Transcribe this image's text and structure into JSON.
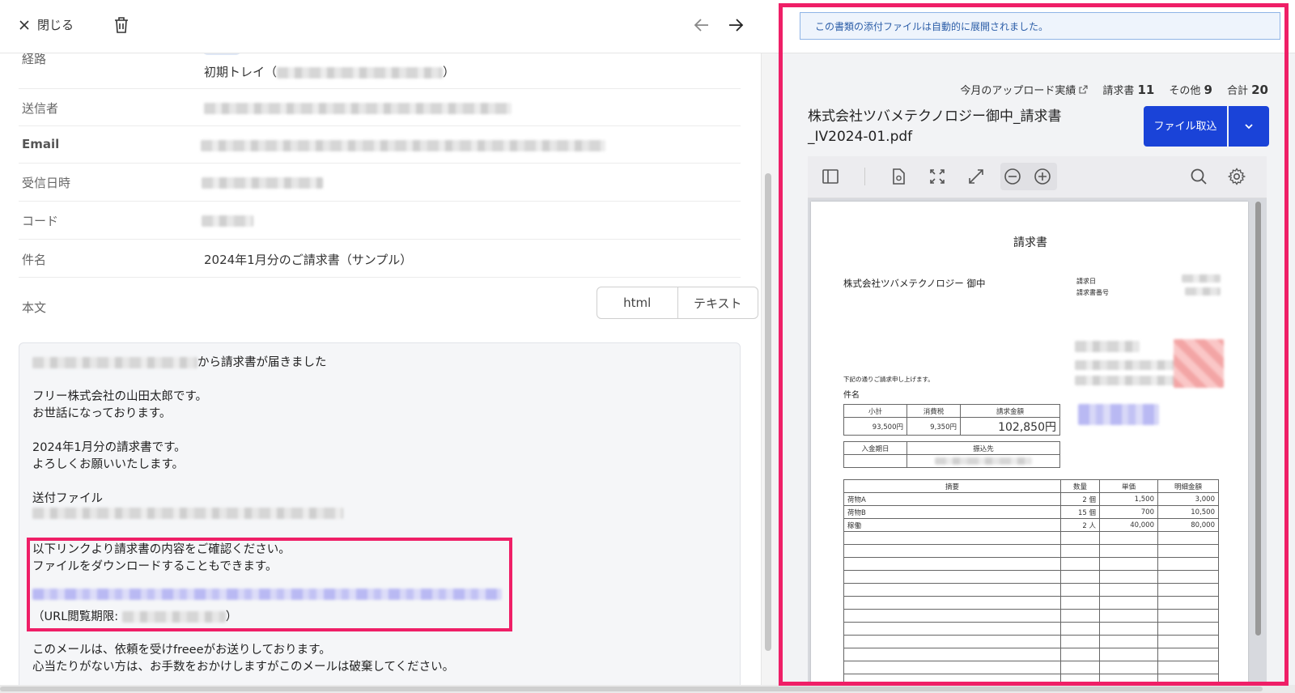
{
  "topbar": {
    "close_label": "閉じる"
  },
  "fields": {
    "route_label": "経路",
    "route_value": "初期トレイ（",
    "route_value_end": "）",
    "sender_label": "送信者",
    "email_label": "Email",
    "received_label": "受信日時",
    "code_label": "コード",
    "subject_label": "件名",
    "subject_value": "2024年1月分のご請求書（サンプル）",
    "body_label": "本文",
    "body_modes": [
      "html",
      "テキスト"
    ]
  },
  "mail_body": {
    "line1_suffix": "から請求書が届きました",
    "line2": "フリー株式会社の山田太郎です。",
    "line3": "お世話になっております。",
    "line4": "2024年1月分の請求書です。",
    "line5": "よろしくお願いいたします。",
    "line6": "送付ファイル",
    "line7": "以下リンクより請求書の内容をご確認ください。",
    "line8": "ファイルをダウンロードすることもできます。",
    "line9_prefix": "（URL閲覧期限: ",
    "line9_suffix": "）",
    "line10": "このメールは、依頼を受けfreeeがお送りしております。",
    "line11": "心当たりがない方は、お手数をおかけしますがこのメールは破棄してください。"
  },
  "right_panel": {
    "notice": "この書類の添付ファイルは自動的に展開されました。",
    "upload_link": "今月のアップロード実績",
    "stat_invoice_label": "請求書",
    "stat_invoice_value": "11",
    "stat_other_label": "その他",
    "stat_other_value": "9",
    "stat_total_label": "合計",
    "stat_total_value": "20",
    "filename": "株式会社ツバメテクノロジー御中_請求書_IV2024-01.pdf",
    "import_button": "ファイル取込"
  },
  "invoice": {
    "title": "請求書",
    "recipient": "株式会社ツバメテクノロジー 御中",
    "date_label": "請求日",
    "number_label": "請求書番号",
    "greeting": "下記の通りご請求申し上げます。",
    "subject_label": "件名",
    "summary_headers": [
      "小計",
      "消費税",
      "請求金額"
    ],
    "summary_values": [
      "93,500円",
      "9,350円",
      "102,850円"
    ],
    "pay_headers": [
      "入金期日",
      "振込先"
    ],
    "item_headers": [
      "摘要",
      "数量",
      "単価",
      "明細金額"
    ],
    "items": [
      [
        "荷物A",
        "2 個",
        "1,500",
        "3,000"
      ],
      [
        "荷物B",
        "15 個",
        "700",
        "10,500"
      ],
      [
        "稼働",
        "2 人",
        "40,000",
        "80,000"
      ]
    ]
  },
  "colors": {
    "accent": "#ef1f67",
    "primary": "#1a43d8",
    "notice_text": "#2c5ea8"
  }
}
